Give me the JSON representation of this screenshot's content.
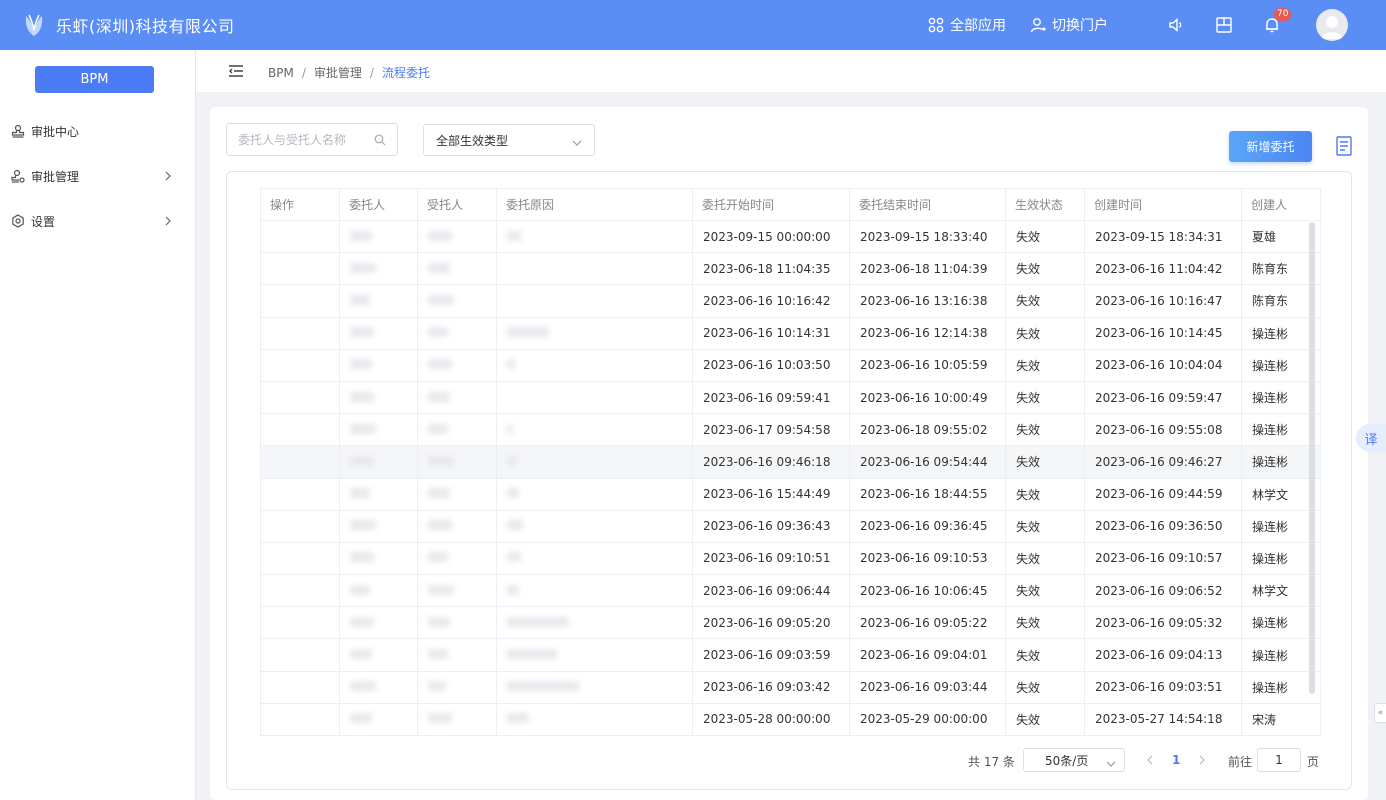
{
  "header": {
    "brand": "乐虾(深圳)科技有限公司",
    "all_apps": "全部应用",
    "switch_portal": "切换门户",
    "notification_count": "70"
  },
  "sidebar": {
    "app_button": "BPM",
    "items": [
      {
        "label": "审批中心",
        "icon": "stamp-icon"
      },
      {
        "label": "审批管理",
        "icon": "stamp-settings-icon"
      },
      {
        "label": "设置",
        "icon": "gear-icon"
      }
    ]
  },
  "breadcrumb": [
    "BPM",
    "审批管理",
    "流程委托"
  ],
  "filters": {
    "search_placeholder": "委托人与受托人名称",
    "effect_type": "全部生效类型"
  },
  "add_button": "新增委托",
  "table": {
    "columns": [
      "操作",
      "委托人",
      "受托人",
      "委托原因",
      "委托开始时间",
      "委托结束时间",
      "生效状态",
      "创建时间",
      "创建人"
    ],
    "rows": [
      {
        "start": "2023-09-15 00:00:00",
        "end": "2023-09-15 18:33:40",
        "status": "失效",
        "created": "2023-09-15 18:34:31",
        "creator": "夏雄"
      },
      {
        "start": "2023-06-18 11:04:35",
        "end": "2023-06-18 11:04:39",
        "status": "失效",
        "created": "2023-06-16 11:04:42",
        "creator": "陈育东"
      },
      {
        "start": "2023-06-16 10:16:42",
        "end": "2023-06-16 13:16:38",
        "status": "失效",
        "created": "2023-06-16 10:16:47",
        "creator": "陈育东"
      },
      {
        "start": "2023-06-16 10:14:31",
        "end": "2023-06-16 12:14:38",
        "status": "失效",
        "created": "2023-06-16 10:14:45",
        "creator": "操连彬"
      },
      {
        "start": "2023-06-16 10:03:50",
        "end": "2023-06-16 10:05:59",
        "status": "失效",
        "created": "2023-06-16 10:04:04",
        "creator": "操连彬"
      },
      {
        "start": "2023-06-16 09:59:41",
        "end": "2023-06-16 10:00:49",
        "status": "失效",
        "created": "2023-06-16 09:59:47",
        "creator": "操连彬"
      },
      {
        "start": "2023-06-17 09:54:58",
        "end": "2023-06-18 09:55:02",
        "status": "失效",
        "created": "2023-06-16 09:55:08",
        "creator": "操连彬"
      },
      {
        "start": "2023-06-16 09:46:18",
        "end": "2023-06-16 09:54:44",
        "status": "失效",
        "created": "2023-06-16 09:46:27",
        "creator": "操连彬"
      },
      {
        "start": "2023-06-16 15:44:49",
        "end": "2023-06-16 18:44:55",
        "status": "失效",
        "created": "2023-06-16 09:44:59",
        "creator": "林学文"
      },
      {
        "start": "2023-06-16 09:36:43",
        "end": "2023-06-16 09:36:45",
        "status": "失效",
        "created": "2023-06-16 09:36:50",
        "creator": "操连彬"
      },
      {
        "start": "2023-06-16 09:10:51",
        "end": "2023-06-16 09:10:53",
        "status": "失效",
        "created": "2023-06-16 09:10:57",
        "creator": "操连彬"
      },
      {
        "start": "2023-06-16 09:06:44",
        "end": "2023-06-16 10:06:45",
        "status": "失效",
        "created": "2023-06-16 09:06:52",
        "creator": "林学文"
      },
      {
        "start": "2023-06-16 09:05:20",
        "end": "2023-06-16 09:05:22",
        "status": "失效",
        "created": "2023-06-16 09:05:32",
        "creator": "操连彬"
      },
      {
        "start": "2023-06-16 09:03:59",
        "end": "2023-06-16 09:04:01",
        "status": "失效",
        "created": "2023-06-16 09:04:13",
        "creator": "操连彬"
      },
      {
        "start": "2023-06-16 09:03:42",
        "end": "2023-06-16 09:03:44",
        "status": "失效",
        "created": "2023-06-16 09:03:51",
        "creator": "操连彬"
      },
      {
        "start": "2023-05-28 00:00:00",
        "end": "2023-05-29 00:00:00",
        "status": "失效",
        "created": "2023-05-27 14:54:18",
        "creator": "宋涛"
      }
    ]
  },
  "pagination": {
    "total": "共 17 条",
    "page_size": "50条/页",
    "current_page": "1",
    "goto_label": "前往",
    "goto_value": "1",
    "page_suffix": "页"
  },
  "side_tabs": {
    "translate": "译",
    "collapse": "«"
  },
  "colors": {
    "header": "#5b8ef5",
    "primary": "#4b7bf5"
  }
}
